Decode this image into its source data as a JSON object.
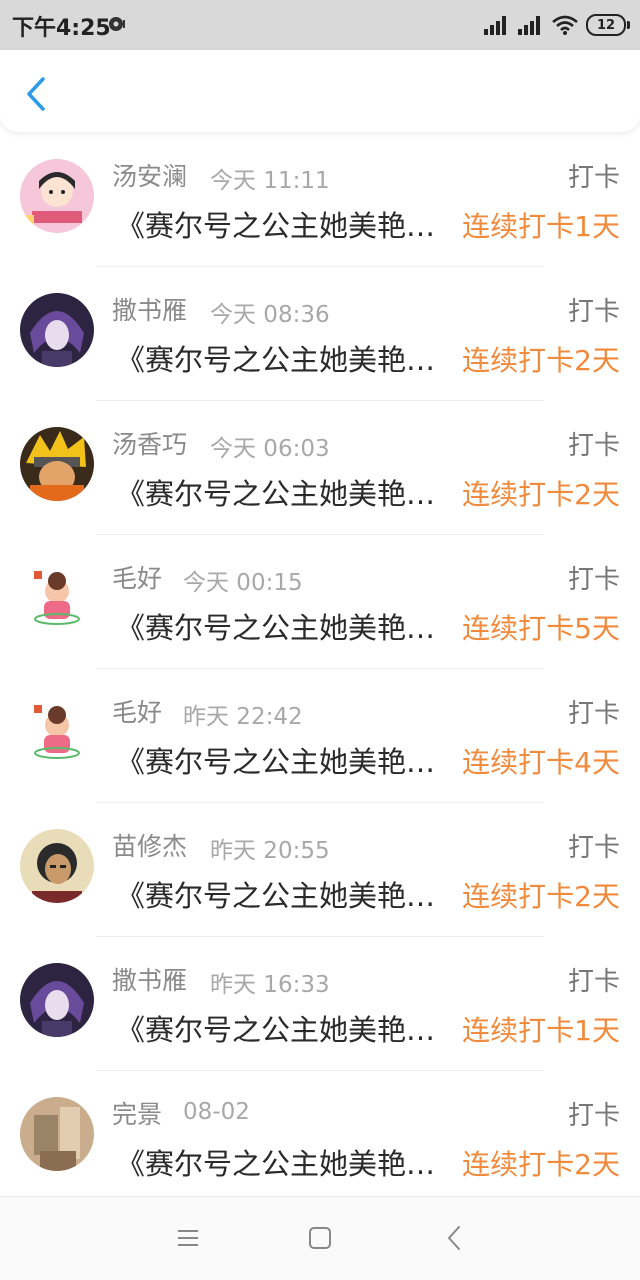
{
  "status_bar": {
    "time": "下午4:25",
    "battery": "12"
  },
  "header": {
    "back_icon": "chevron-left-icon"
  },
  "colors": {
    "accent": "#2e9bea",
    "streak": "#f08a3c"
  },
  "entries": [
    {
      "name": "汤安澜",
      "time": "今天 11:11",
      "tag": "打卡",
      "book": "《赛尔号之公主她美艳动人》",
      "streak": "连续打卡1天",
      "avatar": "avatar-cartoon-girl"
    },
    {
      "name": "撒书雁",
      "time": "今天 08:36",
      "tag": "打卡",
      "book": "《赛尔号之公主她美艳动人》",
      "streak": "连续打卡2天",
      "avatar": "avatar-anime-purple"
    },
    {
      "name": "汤香巧",
      "time": "今天 06:03",
      "tag": "打卡",
      "book": "《赛尔号之公主她美艳动人》",
      "streak": "连续打卡2天",
      "avatar": "avatar-anime-ninja"
    },
    {
      "name": "毛好",
      "time": "今天 00:15",
      "tag": "打卡",
      "book": "《赛尔号之公主她美艳动人》",
      "streak": "连续打卡5天",
      "avatar": "avatar-cartoon-pink"
    },
    {
      "name": "毛好",
      "time": "昨天 22:42",
      "tag": "打卡",
      "book": "《赛尔号之公主她美艳动人》",
      "streak": "连续打卡4天",
      "avatar": "avatar-cartoon-pink"
    },
    {
      "name": "苗修杰",
      "time": "昨天 20:55",
      "tag": "打卡",
      "book": "《赛尔号之公主她美艳动人》",
      "streak": "连续打卡2天",
      "avatar": "avatar-photo-person"
    },
    {
      "name": "撒书雁",
      "time": "昨天 16:33",
      "tag": "打卡",
      "book": "《赛尔号之公主她美艳动人》",
      "streak": "连续打卡1天",
      "avatar": "avatar-anime-purple"
    },
    {
      "name": "完景",
      "time": "08-02",
      "tag": "打卡",
      "book": "《赛尔号之公主她美艳动人》",
      "streak": "连续打卡2天",
      "avatar": "avatar-photo-beige"
    }
  ],
  "nav": {
    "menu_icon": "menu-icon",
    "home_icon": "home-square-icon",
    "back_icon": "back-triangle-icon"
  }
}
